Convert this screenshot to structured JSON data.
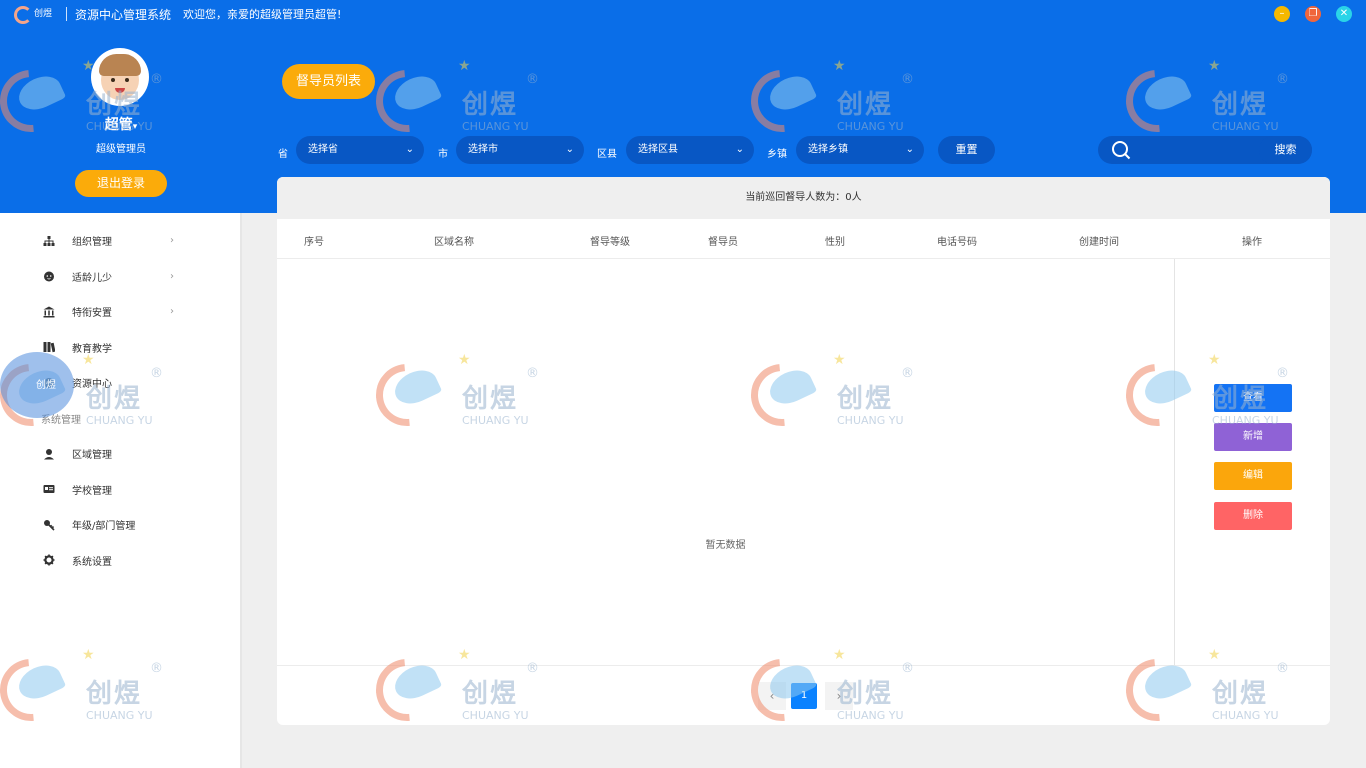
{
  "titlebar": {
    "logo_text": "创煜",
    "title": "资源中心管理系统",
    "welcome": "欢迎您，亲爱的超级管理员超管!"
  },
  "profile": {
    "name": "超管",
    "role": "超级管理员",
    "logout_label": "退出登录"
  },
  "menu": {
    "items": [
      {
        "label": "组织管理",
        "icon": "sitemap-icon",
        "arrow": true
      },
      {
        "label": "适龄儿少",
        "icon": "child-icon",
        "arrow": true
      },
      {
        "label": "特衔安置",
        "icon": "bank-icon",
        "arrow": true
      },
      {
        "label": "教育教学",
        "icon": "books-icon",
        "arrow": false
      },
      {
        "label": "资源中心",
        "icon": "resource-icon",
        "arrow": false
      },
      {
        "label": "系统管理",
        "icon": "",
        "arrow": false,
        "section": true
      },
      {
        "label": "区域管理",
        "icon": "user-pin-icon",
        "arrow": false
      },
      {
        "label": "学校管理",
        "icon": "id-card-icon",
        "arrow": false
      },
      {
        "label": "年级/部门管理",
        "icon": "key-icon",
        "arrow": false
      },
      {
        "label": "系统设置",
        "icon": "gear-icon",
        "arrow": false
      }
    ]
  },
  "content": {
    "tab_label": "督导员列表",
    "filters": {
      "province_label": "省",
      "province_value": "选择省",
      "city_label": "市",
      "city_value": "选择市",
      "county_label": "区县",
      "county_value": "选择区县",
      "town_label": "乡镇",
      "town_value": "选择乡镇",
      "reset_label": "重置",
      "search_placeholder": "",
      "search_label": "搜索"
    },
    "summary": "当前巡回督导人数为：0人",
    "columns": [
      "序号",
      "区域名称",
      "督导等级",
      "督导员",
      "性别",
      "电话号码",
      "创建时间",
      "操作"
    ],
    "empty_text": "暂无数据",
    "actions": {
      "view": "查看",
      "add": "新增",
      "edit": "编辑",
      "delete": "删除"
    },
    "pagination": {
      "prev": "‹",
      "current": "1",
      "next": "›"
    }
  },
  "watermark": {
    "cn": "创煜",
    "en": "CHUANG YU",
    "reg": "®"
  },
  "colors": {
    "primary_blue": "#0a6ee8",
    "dark_blue": "#0857c4",
    "orange": "#fbab0a",
    "view": "#1473f4",
    "add": "#8f62d6",
    "edit": "#fba60c",
    "delete": "#ff6465"
  }
}
